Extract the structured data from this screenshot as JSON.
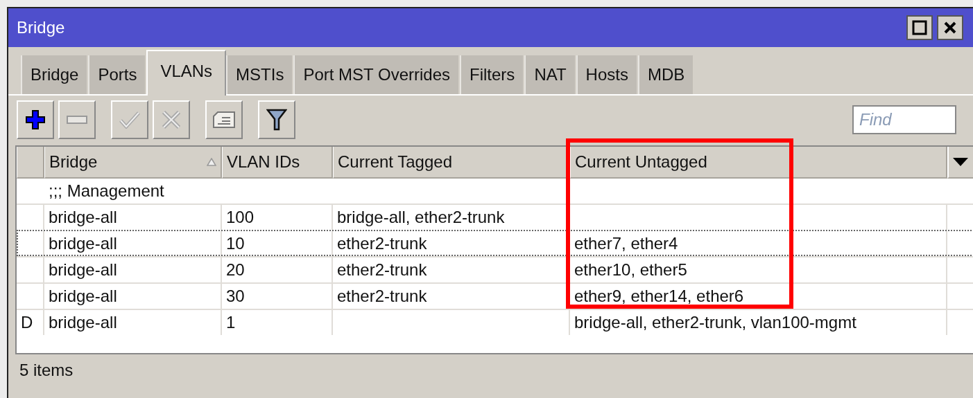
{
  "window": {
    "title": "Bridge"
  },
  "tabs": [
    {
      "label": "Bridge",
      "selected": false
    },
    {
      "label": "Ports",
      "selected": false
    },
    {
      "label": "VLANs",
      "selected": true
    },
    {
      "label": "MSTIs",
      "selected": false
    },
    {
      "label": "Port MST Overrides",
      "selected": false
    },
    {
      "label": "Filters",
      "selected": false
    },
    {
      "label": "NAT",
      "selected": false
    },
    {
      "label": "Hosts",
      "selected": false
    },
    {
      "label": "MDB",
      "selected": false
    }
  ],
  "toolbar": [
    {
      "kind": "add",
      "disabled": false
    },
    {
      "kind": "remove",
      "disabled": false
    },
    {
      "kind": "enable",
      "disabled": false
    },
    {
      "kind": "disable",
      "disabled": false
    },
    {
      "kind": "comment",
      "disabled": false
    },
    {
      "kind": "filter",
      "disabled": false
    }
  ],
  "search": {
    "placeholder": "Find"
  },
  "table": {
    "columns": [
      {
        "sorted": false,
        "highlighted": false
      },
      {
        "label": "Bridge",
        "sorted": true,
        "highlighted": false
      },
      {
        "label": "VLAN IDs",
        "sorted": false,
        "highlighted": false
      },
      {
        "label": "Current Tagged",
        "sorted": false,
        "highlighted": false
      },
      {
        "label": "Current Untagged",
        "sorted": false,
        "highlighted": true
      }
    ],
    "rows": [
      {
        "kind": "comment",
        "text": ";;; Management"
      },
      {
        "kind": "entry",
        "focused": false,
        "cells": [
          "",
          "bridge-all",
          "100",
          "bridge-all, ether2-trunk",
          ""
        ]
      },
      {
        "kind": "entry",
        "focused": true,
        "cells": [
          "",
          "bridge-all",
          "10",
          "ether2-trunk",
          "ether7, ether4"
        ]
      },
      {
        "kind": "entry",
        "focused": false,
        "cells": [
          "",
          "bridge-all",
          "20",
          "ether2-trunk",
          "ether10, ether5"
        ]
      },
      {
        "kind": "entry",
        "focused": false,
        "cells": [
          "",
          "bridge-all",
          "30",
          "ether2-trunk",
          "ether9, ether14, ether6"
        ]
      },
      {
        "kind": "entry",
        "focused": false,
        "cells": [
          "D",
          "bridge-all",
          "1",
          "",
          "bridge-all, ether2-trunk, vlan100-mgmt"
        ]
      }
    ]
  },
  "status_bar": {
    "text": "5 items"
  }
}
